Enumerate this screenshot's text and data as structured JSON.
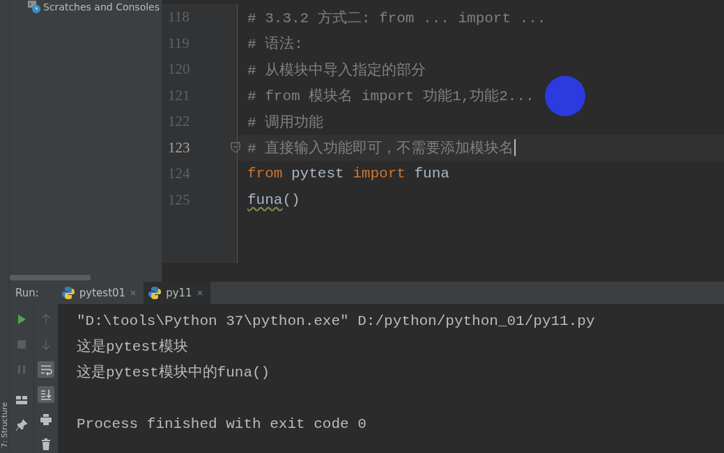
{
  "sidebar": {
    "items": [
      {
        "label": "Scratches and Consoles"
      }
    ]
  },
  "editor": {
    "lines": [
      {
        "number": "118",
        "current": false,
        "tokens": [
          {
            "kind": "comment",
            "text": "# 3.3.2 方式二: from ... import ..."
          }
        ]
      },
      {
        "number": "119",
        "current": false,
        "tokens": [
          {
            "kind": "comment",
            "text": "# 语法:"
          }
        ]
      },
      {
        "number": "120",
        "current": false,
        "tokens": [
          {
            "kind": "comment",
            "text": "# 从模块中导入指定的部分"
          }
        ]
      },
      {
        "number": "121",
        "current": false,
        "tokens": [
          {
            "kind": "comment",
            "text": "# from 模块名 import 功能1,功能2..."
          }
        ]
      },
      {
        "number": "122",
        "current": false,
        "tokens": [
          {
            "kind": "comment",
            "text": "# 调用功能"
          }
        ]
      },
      {
        "number": "123",
        "current": true,
        "tokens": [
          {
            "kind": "comment",
            "text": "# 直接输入功能即可，不需要添加模块名"
          }
        ]
      },
      {
        "number": "124",
        "current": false,
        "tokens": [
          {
            "kind": "keyword",
            "text": "from"
          },
          {
            "kind": "plain",
            "text": "pytest"
          },
          {
            "kind": "keyword",
            "text": "import"
          },
          {
            "kind": "plain",
            "text": "funa"
          }
        ]
      },
      {
        "number": "125",
        "current": false,
        "tokens": [
          {
            "kind": "warning",
            "text": "funa"
          },
          {
            "kind": "punct",
            "text": "()"
          }
        ]
      }
    ]
  },
  "run_panel": {
    "label": "Run:",
    "tabs": [
      {
        "label": "pytest01",
        "selected": false
      },
      {
        "label": "py11",
        "selected": true
      }
    ],
    "left_tools": [
      {
        "kind": "run",
        "active": false
      },
      {
        "kind": "stop",
        "active": false
      },
      {
        "kind": "pause",
        "active": false
      },
      {
        "kind": "layout",
        "active": false
      },
      {
        "kind": "pin",
        "active": false
      }
    ],
    "right_tools": [
      {
        "kind": "up",
        "active": false
      },
      {
        "kind": "down",
        "active": false
      },
      {
        "kind": "wrap",
        "active": true
      },
      {
        "kind": "scroll-end",
        "active": true
      },
      {
        "kind": "print",
        "active": false
      },
      {
        "kind": "trash",
        "active": false
      }
    ],
    "output": [
      {
        "kind": "command",
        "text": "\"D:\\tools\\Python 37\\python.exe\" D:/python/python_01/py11.py"
      },
      {
        "kind": "stdout",
        "text": "这是pytest模块"
      },
      {
        "kind": "stdout",
        "text": "这是pytest模块中的funa()"
      },
      {
        "kind": "exit",
        "text": "Process finished with exit code 0"
      }
    ]
  },
  "side_strip": {
    "label": "7: Structure"
  }
}
